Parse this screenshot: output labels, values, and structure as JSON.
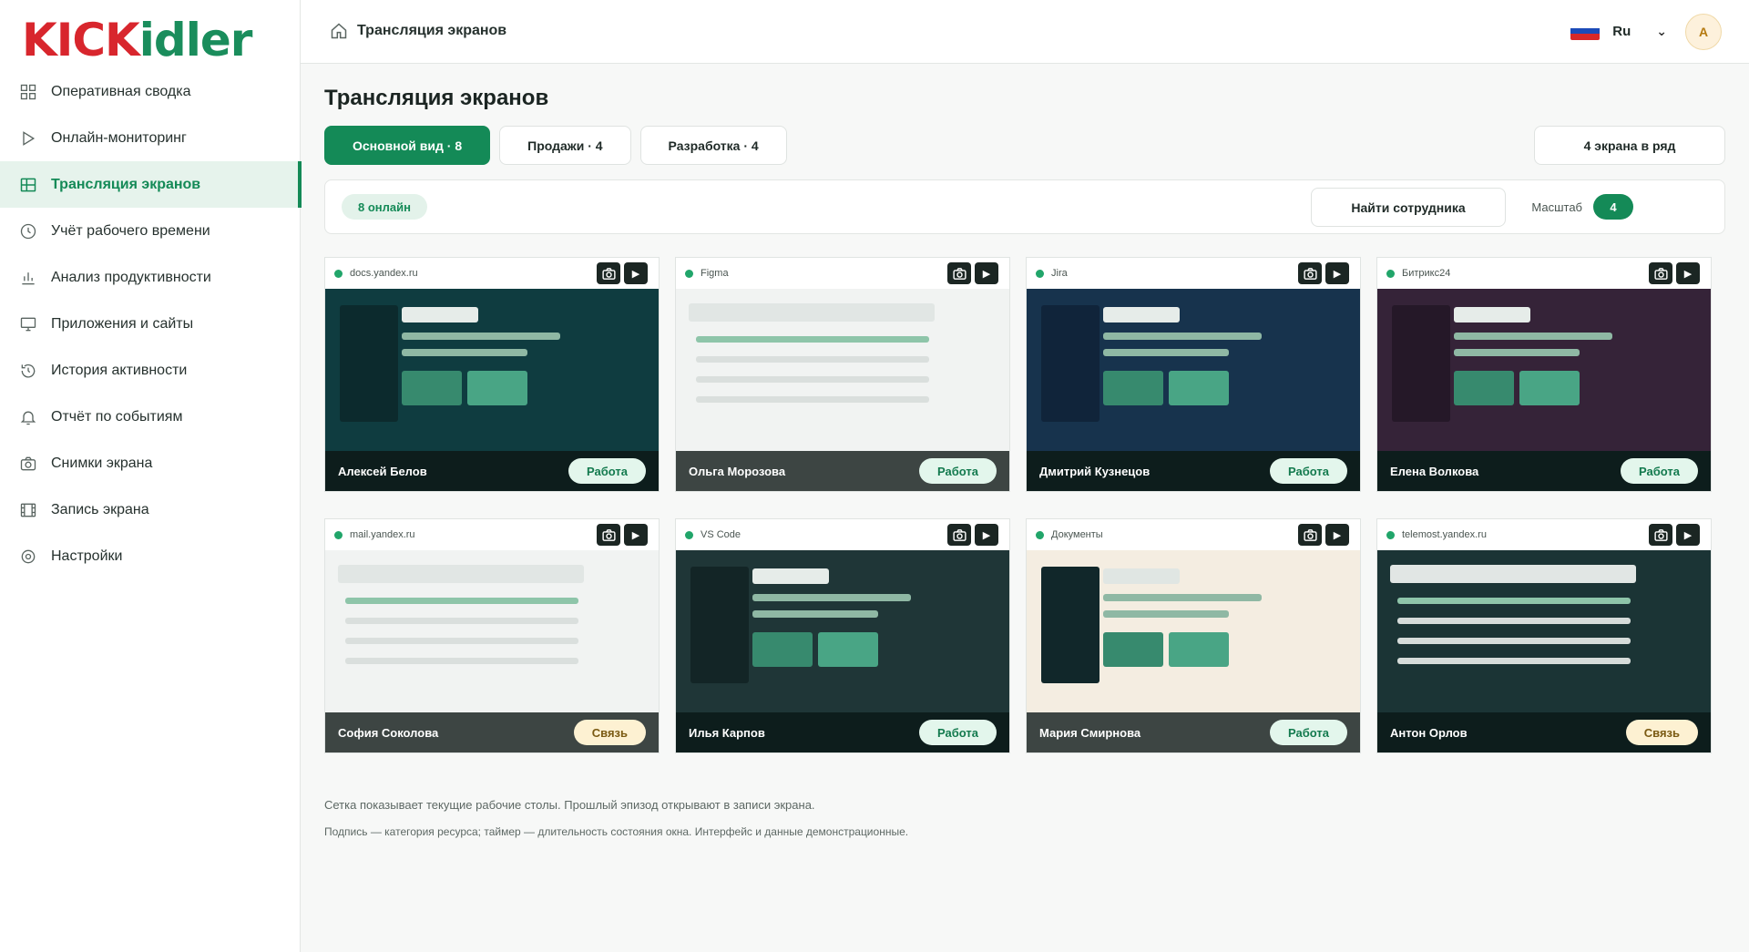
{
  "brand": {
    "logo_part1": "KICK",
    "logo_part2": "idler"
  },
  "sidebar": {
    "items": [
      {
        "label": "Оперативная сводка",
        "icon": "grid-icon"
      },
      {
        "label": "Онлайн-мониторинг",
        "icon": "play-outline-icon"
      },
      {
        "label": "Трансляция экранов",
        "icon": "screens-icon",
        "active": true
      },
      {
        "label": "Учёт рабочего времени",
        "icon": "clock-icon"
      },
      {
        "label": "Анализ продуктивности",
        "icon": "bar-chart-icon"
      },
      {
        "label": "Приложения и сайты",
        "icon": "monitor-icon"
      },
      {
        "label": "История активности",
        "icon": "history-icon"
      },
      {
        "label": "Отчёт по событиям",
        "icon": "bell-icon"
      },
      {
        "label": "Снимки экрана",
        "icon": "camera-icon"
      },
      {
        "label": "Запись экрана",
        "icon": "film-icon"
      },
      {
        "label": "Настройки",
        "icon": "settings-icon"
      }
    ]
  },
  "header": {
    "breadcrumb": "Трансляция экранов",
    "lang": "Ru",
    "avatar": "А"
  },
  "main": {
    "title": "Трансляция экранов",
    "groups": [
      {
        "label": "Основной вид · 8",
        "active": true
      },
      {
        "label": "Продажи · 4",
        "active": false
      },
      {
        "label": "Разработка · 4",
        "active": false
      }
    ],
    "grid_toggle": "4 экрана в ряд",
    "online": "8 онлайн",
    "find": "Найти сотрудника",
    "scale_label": "Масштаб",
    "scale_value": "4"
  },
  "tiles": [
    {
      "source": "docs.yandex.ru",
      "employee": "Алексей Белов",
      "status": "Работа",
      "kind": "work",
      "theme": "teal",
      "layout": "app"
    },
    {
      "source": "Figma",
      "employee": "Ольга Морозова",
      "status": "Работа",
      "kind": "work",
      "theme": "light",
      "layout": "list"
    },
    {
      "source": "Jira",
      "employee": "Дмитрий Кузнецов",
      "status": "Работа",
      "kind": "work",
      "theme": "navy",
      "layout": "app"
    },
    {
      "source": "Битрикс24",
      "employee": "Елена Волкова",
      "status": "Работа",
      "kind": "work",
      "theme": "plum",
      "layout": "app"
    },
    {
      "source": "mail.yandex.ru",
      "employee": "София Соколова",
      "status": "Связь",
      "kind": "comm",
      "theme": "light",
      "layout": "list"
    },
    {
      "source": "VS Code",
      "employee": "Илья Карпов",
      "status": "Работа",
      "kind": "work",
      "theme": "slate",
      "layout": "app"
    },
    {
      "source": "Документы",
      "employee": "Мария Смирнова",
      "status": "Работа",
      "kind": "work",
      "theme": "cream",
      "layout": "app"
    },
    {
      "source": "telemost.yandex.ru",
      "employee": "Антон Орлов",
      "status": "Связь",
      "kind": "comm",
      "theme": "darkteal",
      "layout": "list"
    }
  ],
  "notes": [
    "Сетка показывает текущие рабочие столы. Прошлый эпизод открывают в записи экрана.",
    "Подпись — категория ресурса; таймер — длительность состояния окна. Интерфейс и данные демонстрационные."
  ],
  "colors": {
    "accent": "#148a57",
    "online": "#21a56a",
    "work_badge": "#e3f6ec",
    "comm_badge": "#fdf1d2"
  }
}
